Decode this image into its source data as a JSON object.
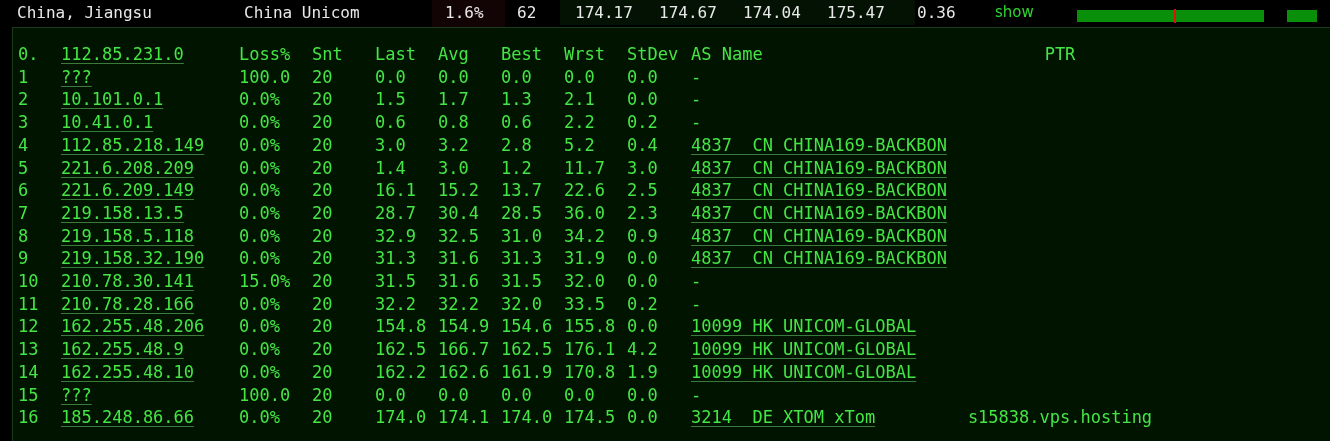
{
  "summary": {
    "location": "China, Jiangsu",
    "isp": "China Unicom",
    "loss": "1.6%",
    "sent": "62",
    "stats": [
      "174.17",
      "174.67",
      "174.04",
      "175.47"
    ],
    "stdev": "0.36",
    "link": "show"
  },
  "table": {
    "columns": [
      {
        "label": "0.",
        "linked": false
      },
      {
        "label": "112.85.231.0",
        "linked": true
      },
      {
        "label": "Loss%",
        "linked": false
      },
      {
        "label": "Snt",
        "linked": false
      },
      {
        "label": "Last",
        "linked": false
      },
      {
        "label": "Avg",
        "linked": false
      },
      {
        "label": "Best",
        "linked": false
      },
      {
        "label": "Wrst",
        "linked": false
      },
      {
        "label": "StDev",
        "linked": false
      },
      {
        "label": "AS Name",
        "linked": false
      },
      {
        "label": "PTR",
        "linked": false
      }
    ],
    "rows": [
      {
        "hop": "1",
        "host": "???",
        "loss": "100.0",
        "snt": "20",
        "last": "0.0",
        "avg": "0.0",
        "best": "0.0",
        "wrst": "0.0",
        "stdev": "0.0",
        "as_name": "-",
        "as_linked": false
      },
      {
        "hop": "2",
        "host": "10.101.0.1",
        "loss": "0.0%",
        "snt": "20",
        "last": "1.5",
        "avg": "1.7",
        "best": "1.3",
        "wrst": "2.1",
        "stdev": "0.0",
        "as_name": "-",
        "as_linked": false
      },
      {
        "hop": "3",
        "host": "10.41.0.1",
        "loss": "0.0%",
        "snt": "20",
        "last": "0.6",
        "avg": "0.8",
        "best": "0.6",
        "wrst": "2.2",
        "stdev": "0.2",
        "as_name": "-",
        "as_linked": false
      },
      {
        "hop": "4",
        "host": "112.85.218.149",
        "loss": "0.0%",
        "snt": "20",
        "last": "3.0",
        "avg": "3.2",
        "best": "2.8",
        "wrst": "5.2",
        "stdev": "0.4",
        "as_name": "4837  CN CHINA169-BACKBON",
        "as_linked": true
      },
      {
        "hop": "5",
        "host": "221.6.208.209",
        "loss": "0.0%",
        "snt": "20",
        "last": "1.4",
        "avg": "3.0",
        "best": "1.2",
        "wrst": "11.7",
        "stdev": "3.0",
        "as_name": "4837  CN CHINA169-BACKBON",
        "as_linked": true
      },
      {
        "hop": "6",
        "host": "221.6.209.149",
        "loss": "0.0%",
        "snt": "20",
        "last": "16.1",
        "avg": "15.2",
        "best": "13.7",
        "wrst": "22.6",
        "stdev": "2.5",
        "as_name": "4837  CN CHINA169-BACKBON",
        "as_linked": true
      },
      {
        "hop": "7",
        "host": "219.158.13.5",
        "loss": "0.0%",
        "snt": "20",
        "last": "28.7",
        "avg": "30.4",
        "best": "28.5",
        "wrst": "36.0",
        "stdev": "2.3",
        "as_name": "4837  CN CHINA169-BACKBON",
        "as_linked": true
      },
      {
        "hop": "8",
        "host": "219.158.5.118",
        "loss": "0.0%",
        "snt": "20",
        "last": "32.9",
        "avg": "32.5",
        "best": "31.0",
        "wrst": "34.2",
        "stdev": "0.9",
        "as_name": "4837  CN CHINA169-BACKBON",
        "as_linked": true
      },
      {
        "hop": "9",
        "host": "219.158.32.190",
        "loss": "0.0%",
        "snt": "20",
        "last": "31.3",
        "avg": "31.6",
        "best": "31.3",
        "wrst": "31.9",
        "stdev": "0.0",
        "as_name": "4837  CN CHINA169-BACKBON",
        "as_linked": true
      },
      {
        "hop": "10",
        "host": "210.78.30.141",
        "loss": "15.0%",
        "snt": "20",
        "last": "31.5",
        "avg": "31.6",
        "best": "31.5",
        "wrst": "32.0",
        "stdev": "0.0",
        "as_name": "-",
        "as_linked": false
      },
      {
        "hop": "11",
        "host": "210.78.28.166",
        "loss": "0.0%",
        "snt": "20",
        "last": "32.2",
        "avg": "32.2",
        "best": "32.0",
        "wrst": "33.5",
        "stdev": "0.2",
        "as_name": "-",
        "as_linked": false
      },
      {
        "hop": "12",
        "host": "162.255.48.206",
        "loss": "0.0%",
        "snt": "20",
        "last": "154.8",
        "avg": "154.9",
        "best": "154.6",
        "wrst": "155.8",
        "stdev": "0.0",
        "as_name": "10099 HK UNICOM-GLOBAL",
        "as_linked": true
      },
      {
        "hop": "13",
        "host": "162.255.48.9",
        "loss": "0.0%",
        "snt": "20",
        "last": "162.5",
        "avg": "166.7",
        "best": "162.5",
        "wrst": "176.1",
        "stdev": "4.2",
        "as_name": "10099 HK UNICOM-GLOBAL",
        "as_linked": true
      },
      {
        "hop": "14",
        "host": "162.255.48.10",
        "loss": "0.0%",
        "snt": "20",
        "last": "162.2",
        "avg": "162.6",
        "best": "161.9",
        "wrst": "170.8",
        "stdev": "1.9",
        "as_name": "10099 HK UNICOM-GLOBAL",
        "as_linked": true
      },
      {
        "hop": "15",
        "host": "???",
        "loss": "100.0",
        "snt": "20",
        "last": "0.0",
        "avg": "0.0",
        "best": "0.0",
        "wrst": "0.0",
        "stdev": "0.0",
        "as_name": "-",
        "as_linked": false
      },
      {
        "hop": "16",
        "host": "185.248.86.66",
        "loss": "0.0%",
        "snt": "20",
        "last": "174.0",
        "avg": "174.1",
        "best": "174.0",
        "wrst": "174.5",
        "stdev": "0.0",
        "as_name": "3214  DE XTOM xTom",
        "as_linked": true,
        "ptr": "s15838.vps.hosting"
      }
    ]
  }
}
